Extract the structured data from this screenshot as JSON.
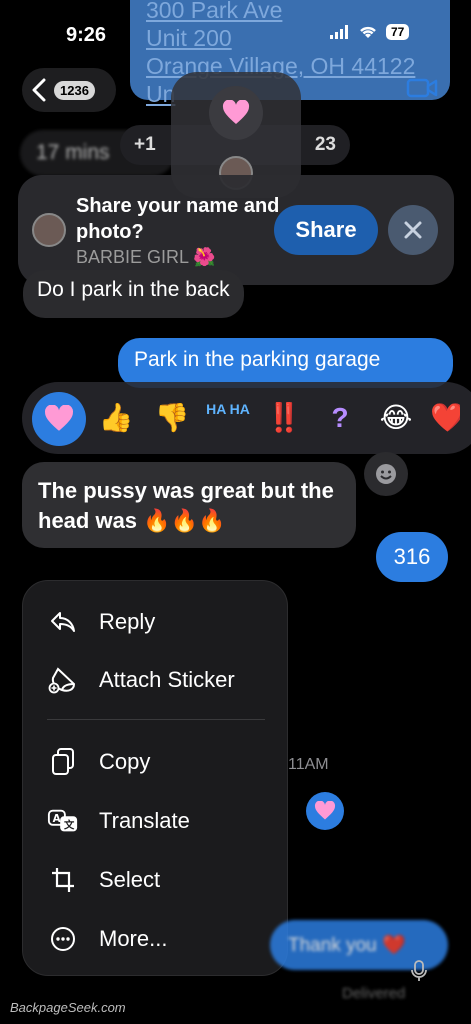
{
  "status": {
    "time": "9:26",
    "battery": "77"
  },
  "nav": {
    "unread_count": "1236"
  },
  "address": {
    "line1": "300 Park Ave",
    "line2": "Unit 200",
    "line3": "Orange Village, OH 44122",
    "line4": "Un"
  },
  "timestamp_pill": {
    "text": "17 mins"
  },
  "plus_pill": {
    "text": "+1",
    "suffix": "23"
  },
  "share_banner": {
    "title": "Share your name and photo?",
    "name": "BARBIE GIRL 🌺",
    "share_label": "Share"
  },
  "messages": {
    "park_question": "Do I park in the back",
    "park_answer": "Park in the parking garage",
    "main_message": "The pussy was great but the head was 🔥🔥🔥",
    "reply_316": "316",
    "thanks": "Thank you ❤️",
    "time_11am": "11AM",
    "delivered": "Delivered"
  },
  "tapbacks": [
    "❤️",
    "👍",
    "👎",
    "HA HA",
    "‼️",
    "?",
    "😂",
    "❤️"
  ],
  "menu": {
    "items": [
      {
        "label": "Reply",
        "icon": "reply-icon"
      },
      {
        "label": "Attach Sticker",
        "icon": "sticker-icon"
      },
      {
        "label": "Copy",
        "icon": "copy-icon"
      },
      {
        "label": "Translate",
        "icon": "translate-icon"
      },
      {
        "label": "Select",
        "icon": "crop-icon"
      },
      {
        "label": "More...",
        "icon": "more-icon"
      }
    ]
  },
  "watermark": "BackpageSeek.com",
  "colors": {
    "accent": "#2c7de0",
    "background": "#000000",
    "bubble_in": "#2f2f32"
  }
}
